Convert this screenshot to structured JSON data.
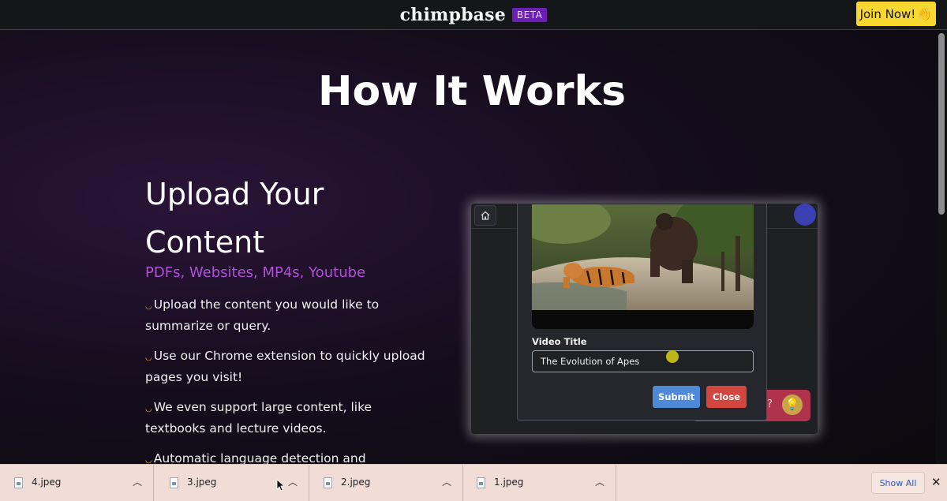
{
  "header": {
    "brand": "chimpbase",
    "badge": "BETA",
    "join_label": "Join Now!",
    "join_emoji": "👋"
  },
  "hero": {
    "title": "How It Works"
  },
  "section": {
    "heading": "Upload Your Content",
    "subtitle": "PDFs, Websites, MP4s, Youtube",
    "features": [
      "Upload the content you would like to summarize or query.",
      "Use our Chrome extension to quickly upload pages you visit!",
      "We even support large content, like textbooks and lecture videos.",
      "Automatic language detection and translation"
    ]
  },
  "demo": {
    "modal": {
      "field_label": "Video Title",
      "field_value": "The Evolution of Apes",
      "submit_label": "Submit",
      "close_label": "Close"
    },
    "chat_snippet": "ns?"
  },
  "downloads": {
    "items": [
      {
        "name": "4.jpeg"
      },
      {
        "name": "3.jpeg"
      },
      {
        "name": "2.jpeg"
      },
      {
        "name": "1.jpeg"
      }
    ],
    "show_all_label": "Show All"
  },
  "colors": {
    "accent_purple": "#b14fdb",
    "join_yellow": "#f7d730",
    "submit_blue": "#4e8ad8",
    "close_red": "#d2463f"
  }
}
